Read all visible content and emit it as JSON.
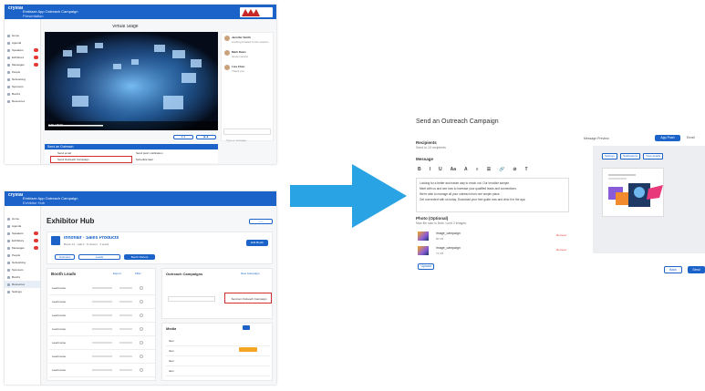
{
  "top_screen": {
    "header": {
      "logo": "crystal",
      "title": "Emblaze App Outreach Campaign",
      "subtitle": "Presentation"
    },
    "sidebar": {
      "items": [
        {
          "label": "Home",
          "icon": "home-icon",
          "badge": false
        },
        {
          "label": "Agenda",
          "icon": "calendar-icon",
          "badge": false
        },
        {
          "label": "Speakers",
          "icon": "mic-icon",
          "badge": true
        },
        {
          "label": "Exhibitors",
          "icon": "store-icon",
          "badge": true
        },
        {
          "label": "Messages",
          "icon": "chat-icon",
          "badge": true
        },
        {
          "label": "People",
          "icon": "people-icon",
          "badge": false
        },
        {
          "label": "Networking",
          "icon": "network-icon",
          "badge": false
        },
        {
          "label": "Sponsors",
          "icon": "star-icon",
          "badge": false
        },
        {
          "label": "Booths",
          "icon": "booth-icon",
          "badge": false
        },
        {
          "label": "Resources",
          "icon": "folder-icon",
          "badge": false
        }
      ]
    },
    "stage_title": "Virtual Stage",
    "chat_messages": [
      {
        "name": "Jennifer Smith",
        "text": "Looking forward to the session"
      },
      {
        "name": "Mark Davis",
        "text": "Great content"
      },
      {
        "name": "Lisa Chen",
        "text": "Thank you"
      }
    ],
    "video_time": "0:45 / 25:00",
    "chat_input_placeholder": "Type a message",
    "campaign_bar_label": "Send an Outreach",
    "options": [
      "Send email",
      "Send push notification",
      "Send Outreach Campaign",
      "Schedule later"
    ]
  },
  "bottom_screen": {
    "header": {
      "logo": "crystal",
      "title": "Emblaze App Outreach Campaign",
      "subtitle": "Exhibitor Hub"
    },
    "page_title": "Exhibitor Hub",
    "sidebar_items": [
      "Home",
      "Agenda",
      "Speakers",
      "Exhibitors",
      "Messages",
      "People",
      "Networking",
      "Sponsors",
      "Booths",
      "Resources",
      "Settings"
    ],
    "company": {
      "name": "Innoflair · Sales Products",
      "meta": "Booth 12 · Hall A · 8 visitors · 3 leads"
    },
    "edit_button": "Edit Booth",
    "tabs": [
      "Overview",
      "Leads",
      "Booth Visitors"
    ],
    "booth_leads": {
      "title": "Booth Leads",
      "actions": [
        "Export",
        "Filter"
      ],
      "rows": [
        "Lead name",
        "Lead name",
        "Lead name",
        "Lead name",
        "Lead name",
        "Lead name",
        "Lead name"
      ]
    },
    "outreach_panel": {
      "title": "Outreach Campaigns",
      "action": "New Campaign",
      "highlighted": "Send an Outreach Campaign",
      "media_title": "Media",
      "media_items": [
        "Item",
        "Item",
        "Item",
        "Item"
      ]
    }
  },
  "modal": {
    "title": "Send an Outreach Campaign",
    "recipients_label": "Recipients",
    "recipients_value": "Send to 10 recipients",
    "message_label": "Message",
    "toolbar": [
      "B",
      "I",
      "U",
      "Aa",
      "A",
      "≡",
      "☰",
      "🔗",
      "⊘",
      "T"
    ],
    "message_text": [
      "Looking for a better and easier way to reach out. Our Innoflair sample.",
      "Meet with us and see how to increase your qualified leads and connections.",
      "We're able to manage all your outreach from one simple place.",
      "Get connected with us today. Download your free guide now and view it in the app."
    ],
    "photo_label": "Photo (Optional)",
    "photo_hint": "Max file size is 5mb. Limit 2 images.",
    "attachments": [
      {
        "name": "image_campaign",
        "size": "80 KB",
        "remove": "Remove"
      },
      {
        "name": "image_campaign",
        "size": "72 KB",
        "remove": "Remove"
      }
    ],
    "upload_button": "Upload",
    "preview_label": "Message Preview",
    "preview_tabs": [
      "App Push",
      "Email"
    ],
    "preview_chips": [
      "Settings",
      "Notifications",
      "View details"
    ],
    "back_button": "Back",
    "send_button": "Send"
  },
  "colors": {
    "brand_blue": "#1b63c9",
    "arrow_blue": "#29a3e3",
    "highlight_red": "#d32f2f",
    "badge_red": "#e53935"
  }
}
